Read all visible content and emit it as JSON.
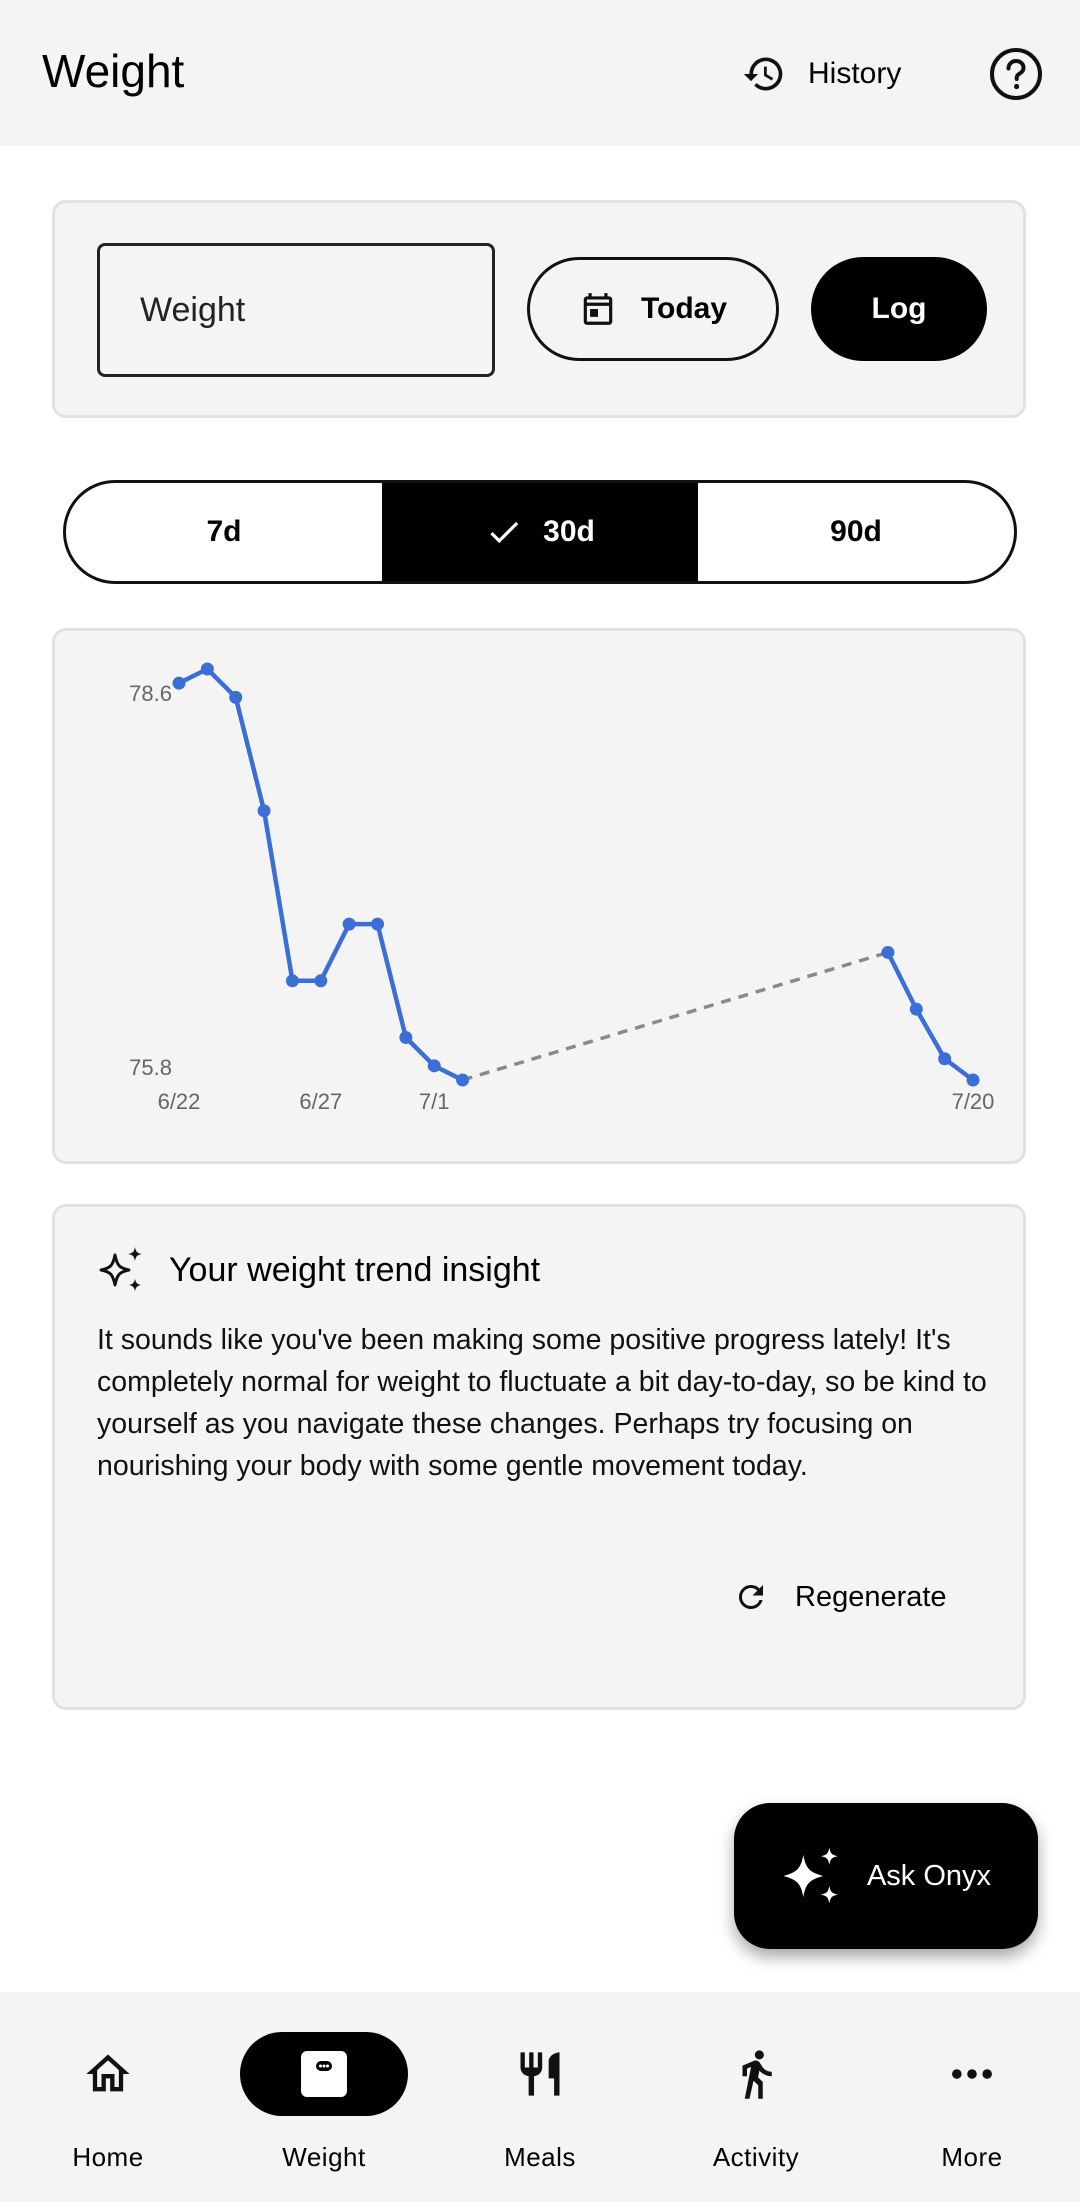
{
  "header": {
    "title": "Weight",
    "history_label": "History",
    "help_icon": "help-circle-icon"
  },
  "entry": {
    "weight_placeholder": "Weight",
    "date_label": "Today",
    "log_label": "Log"
  },
  "range": {
    "options": [
      "7d",
      "30d",
      "90d"
    ],
    "selected": "30d"
  },
  "chart_data": {
    "type": "line",
    "x": [
      "6/22",
      "6/23",
      "6/24",
      "6/25",
      "6/26",
      "6/27",
      "6/28",
      "6/29",
      "6/30",
      "7/1",
      "7/2",
      "7/17",
      "7/18",
      "7/19",
      "7/20"
    ],
    "values": [
      78.6,
      78.7,
      78.5,
      77.7,
      76.5,
      76.5,
      76.9,
      76.9,
      76.1,
      75.9,
      75.8,
      76.7,
      76.3,
      75.95,
      75.8
    ],
    "gap": {
      "from": "7/2",
      "to": "7/17",
      "style": "dashed"
    },
    "ytick_labels": [
      "78.6",
      "75.8"
    ],
    "xtick_labels": [
      "6/22",
      "6/27",
      "7/1",
      "7/20"
    ],
    "ylim": [
      75.8,
      78.7
    ],
    "line_color": "#3b6fd6",
    "gap_color": "#8a8a8a"
  },
  "insight": {
    "title": "Your weight trend insight",
    "body": "It sounds like you've been making some positive progress lately! It's completely normal for weight to fluctuate a bit day-to-day, so be kind to yourself as you navigate these changes. Perhaps try focusing on nourishing your body with some gentle movement today.",
    "regenerate_label": "Regenerate"
  },
  "fab": {
    "label": "Ask Onyx"
  },
  "nav": {
    "items": [
      {
        "label": "Home",
        "icon": "home-icon",
        "active": false
      },
      {
        "label": "Weight",
        "icon": "scale-icon",
        "active": true
      },
      {
        "label": "Meals",
        "icon": "restaurant-icon",
        "active": false
      },
      {
        "label": "Activity",
        "icon": "walk-icon",
        "active": false
      },
      {
        "label": "More",
        "icon": "more-horiz-icon",
        "active": false
      }
    ]
  }
}
